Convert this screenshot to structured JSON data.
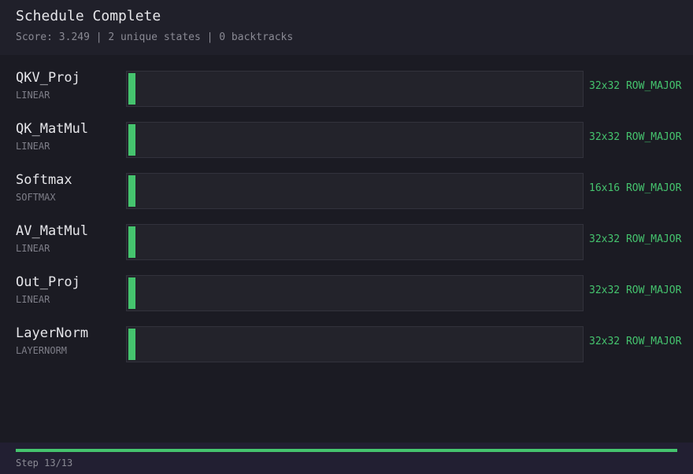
{
  "header": {
    "title": "Schedule Complete",
    "summary": "Score: 3.249 | 2 unique states | 0 backtracks"
  },
  "operations": [
    {
      "name": "QKV_Proj",
      "type": "LINEAR",
      "tile": "32x32 ROW_MAJOR"
    },
    {
      "name": "QK_MatMul",
      "type": "LINEAR",
      "tile": "32x32 ROW_MAJOR"
    },
    {
      "name": "Softmax",
      "type": "SOFTMAX",
      "tile": "16x16 ROW_MAJOR"
    },
    {
      "name": "AV_MatMul",
      "type": "LINEAR",
      "tile": "32x32 ROW_MAJOR"
    },
    {
      "name": "Out_Proj",
      "type": "LINEAR",
      "tile": "32x32 ROW_MAJOR"
    },
    {
      "name": "LayerNorm",
      "type": "LAYERNORM",
      "tile": "32x32 ROW_MAJOR"
    }
  ],
  "footer": {
    "step_label": "Step 13/13",
    "progress": 1.0
  },
  "colors": {
    "accent": "#45c46e",
    "background": "#1b1b23",
    "header_background": "#20202a",
    "footer_background": "#221f32"
  }
}
